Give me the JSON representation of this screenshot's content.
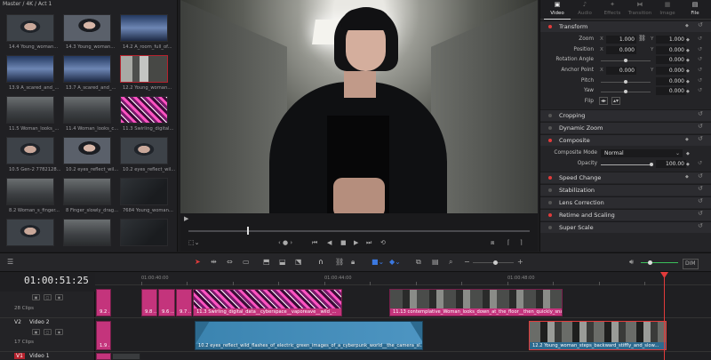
{
  "media_pool": {
    "path": "Master / 4K / Act 1",
    "clips": [
      {
        "label": "14.4 Young_woman...",
        "thumb": "t-face",
        "selected": false
      },
      {
        "label": "14.3 Young_woman...",
        "thumb": "t-face2",
        "selected": false
      },
      {
        "label": "14.2 A_room_full_of...",
        "thumb": "t-blue",
        "selected": false
      },
      {
        "label": "13.9 A_scared_and_...",
        "thumb": "t-blue",
        "selected": false
      },
      {
        "label": "13.7 A_scared_and_...",
        "thumb": "t-blue",
        "selected": false
      },
      {
        "label": "12.2 Young_woman...",
        "thumb": "t-hall",
        "selected": true
      },
      {
        "label": "11.5 Woman_looks_...",
        "thumb": "t-floor",
        "selected": false
      },
      {
        "label": "11.4 Woman_looks_c...",
        "thumb": "t-floor",
        "selected": false
      },
      {
        "label": "11.3 Swirling_digital...",
        "thumb": "t-pink",
        "selected": false
      },
      {
        "label": "10.5 Gen-2 7782128...",
        "thumb": "t-face",
        "selected": false
      },
      {
        "label": "10.2 eyes_reflect_wil...",
        "thumb": "t-face2",
        "selected": false
      },
      {
        "label": "10.2 eyes_reflect_wil...",
        "thumb": "t-face",
        "selected": false
      },
      {
        "label": "8.2 Woman_s_finger...",
        "thumb": "t-floor",
        "selected": false
      },
      {
        "label": "8 Finger_slowly_drag...",
        "thumb": "t-floor",
        "selected": false
      },
      {
        "label": "7684 Young_woman...",
        "thumb": "t-dark",
        "selected": false
      },
      {
        "label": "",
        "thumb": "t-face",
        "selected": false
      },
      {
        "label": "",
        "thumb": "t-floor",
        "selected": false
      },
      {
        "label": "",
        "thumb": "t-dark",
        "selected": false
      }
    ]
  },
  "viewer": {
    "icons": {
      "frame_marker": "play-marker-icon",
      "transform": "transform-icon",
      "prev_clip": "skip-back-icon",
      "reverse": "play-reverse-icon",
      "stop": "stop-icon",
      "play": "play-icon",
      "next_clip": "skip-forward-icon",
      "loop": "loop-icon"
    }
  },
  "inspector": {
    "tabs": [
      {
        "label": "Video",
        "icon": "video-icon",
        "active": true
      },
      {
        "label": "Audio",
        "icon": "audio-icon",
        "active": false
      },
      {
        "label": "Effects",
        "icon": "effects-icon",
        "active": false
      },
      {
        "label": "Transition",
        "icon": "transition-icon",
        "active": false
      },
      {
        "label": "Image",
        "icon": "image-icon",
        "active": false
      },
      {
        "label": "File",
        "icon": "file-icon",
        "active": true
      }
    ],
    "transform": {
      "title": "Transform",
      "zoom": {
        "label": "Zoom",
        "x_axis": "X",
        "x": "1.000",
        "y_axis": "Y",
        "y": "1.000"
      },
      "position": {
        "label": "Position",
        "x_axis": "X",
        "x": "0.000",
        "y_axis": "Y",
        "y": "0.000"
      },
      "rotation": {
        "label": "Rotation Angle",
        "value": "0.000"
      },
      "anchor": {
        "label": "Anchor Point",
        "x_axis": "X",
        "x": "0.000",
        "y_axis": "Y",
        "y": "0.000"
      },
      "pitch": {
        "label": "Pitch",
        "value": "0.000"
      },
      "yaw": {
        "label": "Yaw",
        "value": "0.000"
      },
      "flip": {
        "label": "Flip"
      }
    },
    "sections": {
      "cropping": "Cropping",
      "dynamic_zoom": "Dynamic Zoom",
      "composite": "Composite",
      "composite_mode_label": "Composite Mode",
      "composite_mode": "Normal",
      "opacity_label": "Opacity",
      "opacity": "100.00",
      "speed_change": "Speed Change",
      "stabilization": "Stabilization",
      "lens_correction": "Lens Correction",
      "retime_scaling": "Retime and Scaling",
      "super_scale": "Super Scale"
    }
  },
  "toolbar": {
    "dim_label": "DIM"
  },
  "timeline": {
    "timecode": "01:00:51:25",
    "ruler": [
      "01:00:40:00",
      "01:00:44:00",
      "01:00:48:00"
    ],
    "tracks": {
      "v3_clips": "28 Clips",
      "v2_id": "V2",
      "v2_name": "Video 2",
      "v2_clips": "17 Clips",
      "v1_id": "V1",
      "v1_name": "Video 1"
    },
    "clip_labels": {
      "a": "9.2 ...",
      "b": "9.8 ...",
      "c": "9.6 ...",
      "d": "9.7 ...",
      "e": "11.3 Swirling_digital_data__cyberspace__vaporeave__wild_...",
      "f": "11.13 contemplative_Woman_looks_down_at_the_floor__then_quickly_snaps_a...",
      "g": "1.9 ...",
      "h": "10.2 eyes_reflect_wild_flashes_of_electric_green_images_of_a_cyberpunk_world__the_camera_sl...",
      "i": "12.2 Young_woman_steps_backward_stiffly_and_slow..."
    }
  }
}
